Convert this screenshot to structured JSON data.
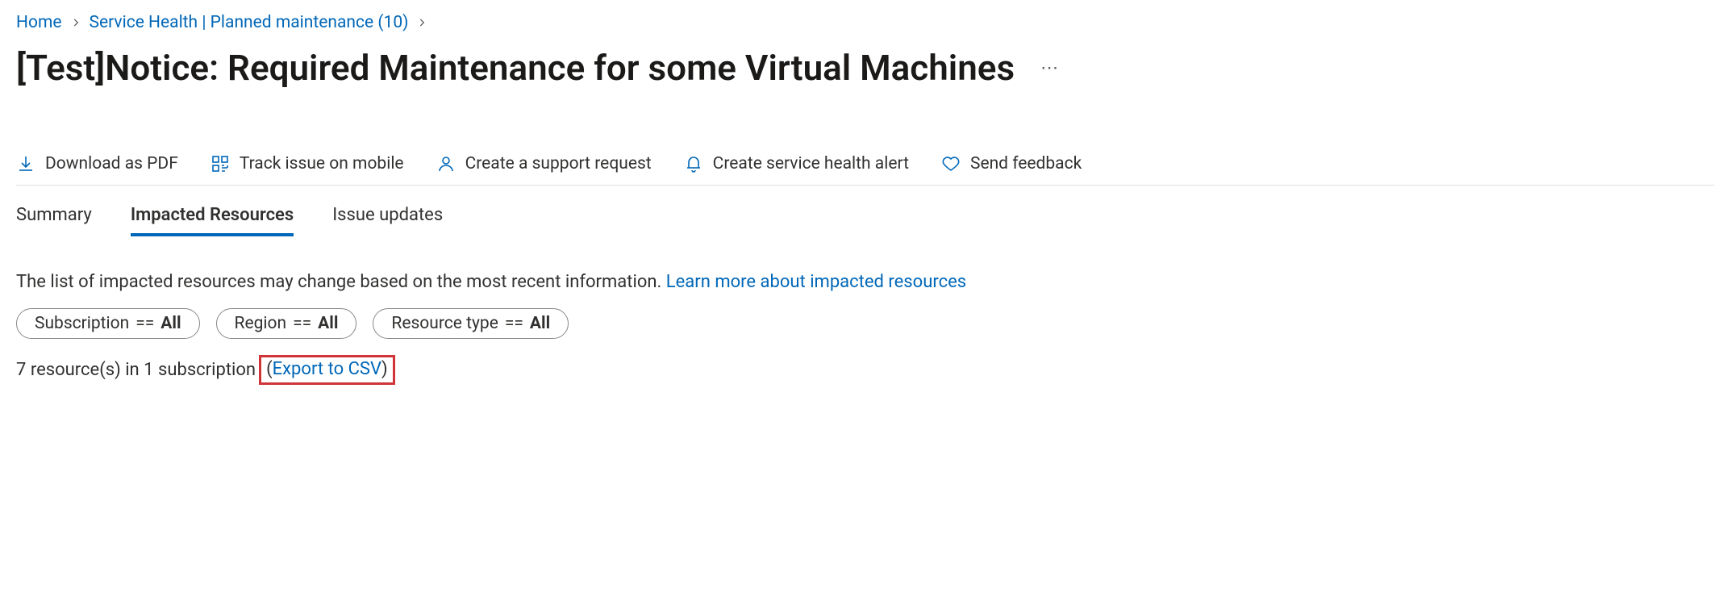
{
  "breadcrumb": {
    "items": [
      {
        "label": "Home"
      },
      {
        "label": "Service Health | Planned maintenance (10)"
      }
    ]
  },
  "page": {
    "title": "[Test]Notice: Required Maintenance for some Virtual Machines",
    "more": "⋯"
  },
  "toolbar": {
    "download_pdf": "Download as PDF",
    "track_mobile": "Track issue on mobile",
    "support_request": "Create a support request",
    "health_alert": "Create service health alert",
    "feedback": "Send feedback"
  },
  "tabs": {
    "summary": "Summary",
    "impacted": "Impacted Resources",
    "updates": "Issue updates"
  },
  "info": {
    "text": "The list of impacted resources may change based on the most recent information.  ",
    "link": "Learn more about impacted resources"
  },
  "filters": {
    "subscription": {
      "label": "Subscription",
      "op": "==",
      "value": "All"
    },
    "region": {
      "label": "Region",
      "op": "==",
      "value": "All"
    },
    "resource_type": {
      "label": "Resource type",
      "op": "==",
      "value": "All"
    }
  },
  "summary": {
    "text": "7 resource(s) in 1 subscription ",
    "paren_open": "(",
    "export": "Export to CSV",
    "paren_close": ")"
  }
}
